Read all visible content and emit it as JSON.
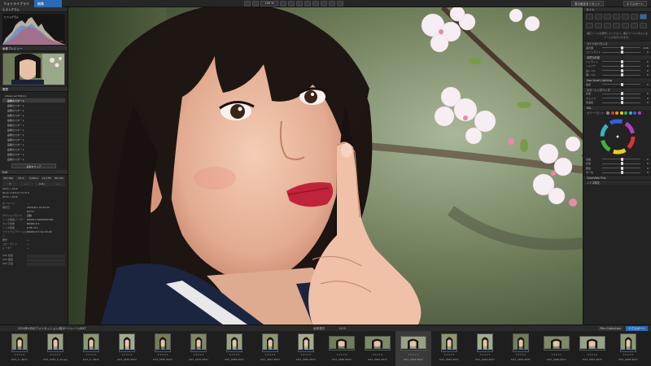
{
  "topbar": {
    "tab_library": "フォトライブラリ",
    "tab_edit": "編集",
    "zoom": "100 %",
    "right_button_1": "表示設定をリセット",
    "right_button_2": "エクスポート"
  },
  "left": {
    "header_histogram": "ヒストグラム",
    "histogram_label": "ヒストグラム",
    "histogram_rgb": "265  224  200",
    "header_preview": "画像プレビュー",
    "header_history": "履歴",
    "history_root": "Advanced History",
    "history_items": [
      "画像のスタート",
      "画像のスタート",
      "画像のスタート",
      "画像のスタート",
      "画像のスタート",
      "画像のスタート",
      "画像のスタート",
      "画像のスタート",
      "画像のスタート",
      "画像のスタート",
      "画像のスタート",
      "画像のスタート",
      "画像のスタート"
    ],
    "history_button": "最新をクリア",
    "header_exif": "Exif",
    "exif_row1": [
      "ISO 100",
      "f/1.4",
      "1/200 s",
      "+0.3 EV",
      "85 mm"
    ],
    "exif_row2": [
      "X",
      "—",
      "Auto",
      "—"
    ],
    "info_lines": [
      "6016 x 4016",
      "Nikon Z 85mm f/1.8 S",
      "6016 x 4016"
    ],
    "meta": [
      {
        "k": "キーワード",
        "v": "—"
      },
      {
        "k": "撮影日",
        "v": "2024/4/1 14:29:31"
      },
      {
        "k": "",
        "v": "DXT-0"
      },
      {
        "k": "ホワイトバランス",
        "v": "自動"
      },
      {
        "k": "レンズ製造メーカー",
        "v": "NIKON CORPORATION"
      },
      {
        "k": "カメラ本体",
        "v": "NIKON Z 6"
      },
      {
        "k": "レンズ型番",
        "v": "Z 85 mm"
      },
      {
        "k": "ソフトウェアバージョン",
        "v": "NIKON Z 6 Ver.03.00"
      },
      {
        "k": "著作",
        "v": "—"
      },
      {
        "k": "コピーライト",
        "v": "—"
      },
      {
        "k": "ルーター",
        "v": "—"
      }
    ],
    "gps_labels": [
      "GPS 緯度",
      "GPS 経度",
      "GPS 高度"
    ]
  },
  "right": {
    "header": "ライト",
    "hint": "補正ツールを選択してください。補正ツールパネルにはツールが表示されます。",
    "sections": [
      {
        "title": "ライトのバランス",
        "sliders": [
          {
            "label": "露光量",
            "value": "0.00"
          },
          {
            "label": "コントラスト",
            "value": "0"
          }
        ]
      },
      {
        "title": "自然な彩度",
        "sliders": [
          {
            "label": "ハイライト",
            "value": "0"
          },
          {
            "label": "シャドウ",
            "value": "0"
          },
          {
            "label": "白レベル",
            "value": "0"
          },
          {
            "label": "黒レベル",
            "value": "0"
          }
        ]
      },
      {
        "title": "Dxo Smart Lighting",
        "sliders": [
          {
            "label": "強度",
            "value": "0"
          }
        ]
      },
      {
        "title": "カラーレンダリング",
        "sliders": [
          {
            "label": "彩度",
            "value": "0"
          },
          {
            "label": "ヴァイブ",
            "value": "0"
          },
          {
            "label": "色温度",
            "value": "0"
          }
        ]
      },
      {
        "title": "HSL",
        "sliders": []
      }
    ],
    "hsl_label": "カラーバランス",
    "bottom_sliders": [
      {
        "label": "色相",
        "value": "0"
      },
      {
        "label": "彩度",
        "value": "0"
      },
      {
        "label": "輝度",
        "value": "0"
      },
      {
        "label": "均一性",
        "value": "0"
      }
    ],
    "bottom_sections": [
      "ClearView Plus",
      "ノイズ除去"
    ],
    "colors": [
      "#888888",
      "#e03030",
      "#f08c20",
      "#e8d020",
      "#40b040",
      "#30b8c0",
      "#3060e0",
      "#b040c0"
    ]
  },
  "filmbar": {
    "path": "2024年4月のフォトセッション/桜ポートレート/DXT",
    "center": "画像選択",
    "count": "1425",
    "btn_1": "Film Collection",
    "btn_2": "エクスポート"
  },
  "filmstrip": [
    {
      "name": "DXT_0...9637",
      "sel": false,
      "land": false
    },
    {
      "name": "DXT_2455_S_25.jpg",
      "sel": false,
      "land": false
    },
    {
      "name": "DXT_0...9647",
      "sel": false,
      "land": false
    },
    {
      "name": "DXT_2456 9647",
      "sel": false,
      "land": false
    },
    {
      "name": "DXT_2455 9637",
      "sel": false,
      "land": false
    },
    {
      "name": "DXT_2475 9637",
      "sel": false,
      "land": false
    },
    {
      "name": "DXT_2468 9637",
      "sel": false,
      "land": false
    },
    {
      "name": "DXT_2453 9637",
      "sel": false,
      "land": false
    },
    {
      "name": "DXT_2450 9637",
      "sel": false,
      "land": false
    },
    {
      "name": "DXT_2460 9637",
      "sel": false,
      "land": true
    },
    {
      "name": "DXT_2461 9637",
      "sel": false,
      "land": true
    },
    {
      "name": "DXT_2463 9637",
      "sel": true,
      "land": true
    },
    {
      "name": "DXT_2462 9637",
      "sel": false,
      "land": false
    },
    {
      "name": "DXT_2463 9637",
      "sel": false,
      "land": false
    },
    {
      "name": "DXT_2464 9637",
      "sel": false,
      "land": false
    },
    {
      "name": "DXT_2466 9637",
      "sel": false,
      "land": true
    },
    {
      "name": "DXT_2467 9637",
      "sel": false,
      "land": true
    },
    {
      "name": "DXT_2468 9637",
      "sel": false,
      "land": false
    }
  ]
}
